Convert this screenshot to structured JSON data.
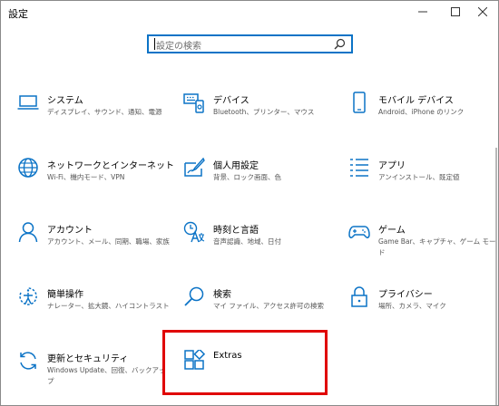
{
  "window": {
    "title": "設定"
  },
  "search": {
    "placeholder": "設定の検索"
  },
  "tiles": [
    {
      "name": "システム",
      "desc": "ディスプレイ、サウンド、通知、電源",
      "icon": "laptop-icon"
    },
    {
      "name": "デバイス",
      "desc": "Bluetooth、プリンター、マウス",
      "icon": "keyboard-icon"
    },
    {
      "name": "モバイル デバイス",
      "desc": "Android、iPhone のリンク",
      "icon": "phone-icon"
    },
    {
      "name": "ネットワークとインターネット",
      "desc": "Wi-Fi、機内モード、VPN",
      "icon": "globe-icon"
    },
    {
      "name": "個人用設定",
      "desc": "背景、ロック画面、色",
      "icon": "paint-icon"
    },
    {
      "name": "アプリ",
      "desc": "アンインストール、既定値",
      "icon": "app-list-icon"
    },
    {
      "name": "アカウント",
      "desc": "アカウント、メール、同期、職場、家族",
      "icon": "person-icon"
    },
    {
      "name": "時刻と言語",
      "desc": "音声認識、地域、日付",
      "icon": "time-language-icon"
    },
    {
      "name": "ゲーム",
      "desc": "Game Bar、キャプチャ、ゲーム モード",
      "icon": "gamepad-icon"
    },
    {
      "name": "簡単操作",
      "desc": "ナレーター、拡大鏡、ハイコントラスト",
      "icon": "ease-of-access-icon"
    },
    {
      "name": "検索",
      "desc": "マイ ファイル、アクセス許可の検索",
      "icon": "magnifier-icon"
    },
    {
      "name": "プライバシー",
      "desc": "場所、カメラ、マイク",
      "icon": "lock-icon"
    },
    {
      "name": "更新とセキュリティ",
      "desc": "Windows Update、回復、バックアップ",
      "icon": "update-icon"
    },
    {
      "name": "Extras",
      "desc": "",
      "icon": "extras-icon"
    }
  ],
  "colors": {
    "accent": "#0b73c6",
    "highlight": "#e00000"
  }
}
